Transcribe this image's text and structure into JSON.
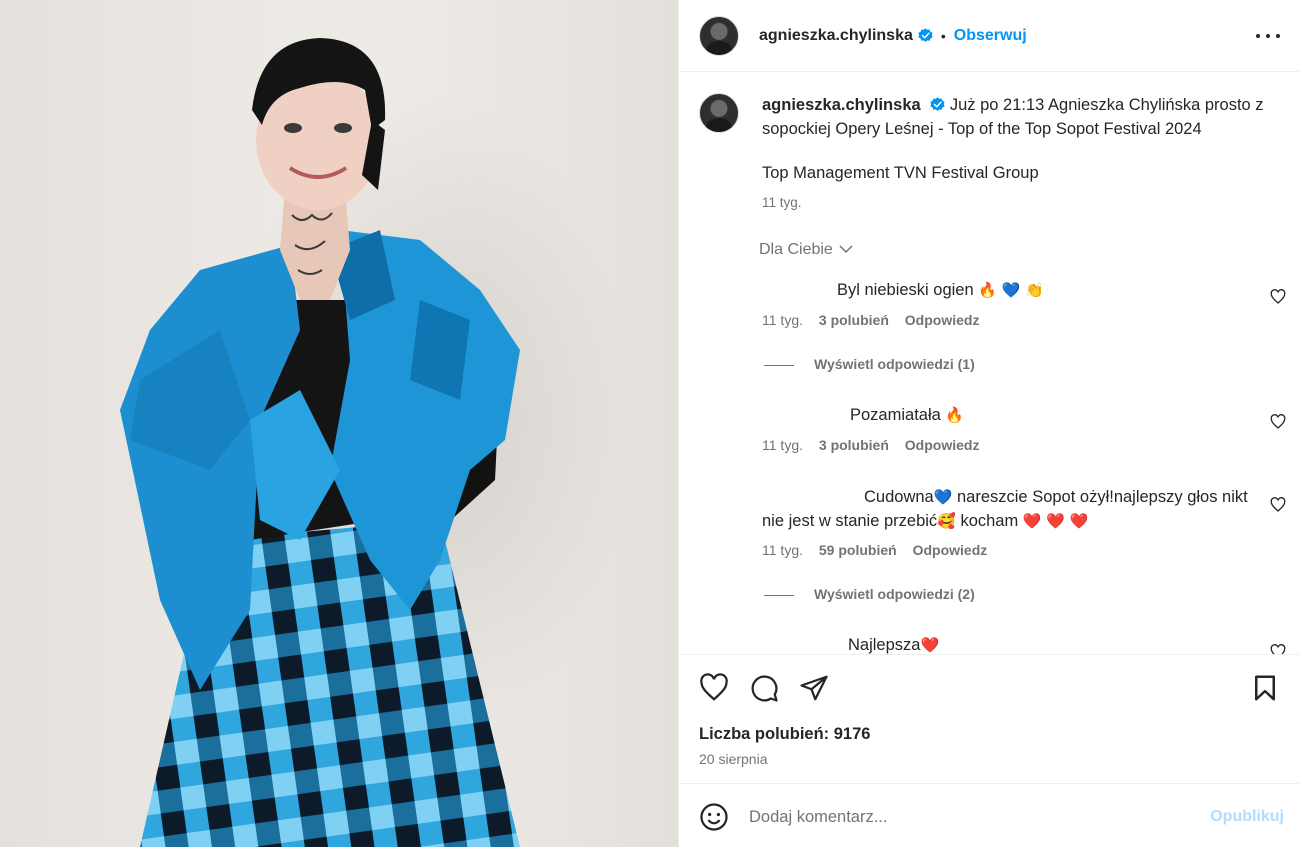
{
  "post": {
    "username": "agnieszka.chylinska",
    "follow_label": "Obserwuj",
    "dot": "•"
  },
  "caption": {
    "username": "agnieszka.chylinska",
    "text": "Już po 21:13 Agnieszka Chylińska prosto z sopockiej Opery Leśnej - Top of the Top Sopot Festival 2024",
    "extra": "Top Management TVN Festival Group",
    "time": "11 tyg."
  },
  "sort_label": "Dla Ciebie",
  "comments": [
    {
      "text": "Byl niebieski ogien",
      "emojis": "🔥 💙 👏",
      "time": "11 tyg.",
      "likes": "3 polubień",
      "reply": "Odpowiedz",
      "view_replies": "Wyświetl odpowiedzi (1)"
    },
    {
      "text": "Pozamiatała",
      "emojis": "🔥",
      "time": "11 tyg.",
      "likes": "3 polubień",
      "reply": "Odpowiedz"
    },
    {
      "text_a": "Cudowna",
      "emoji_a": "💙",
      "text_b": " nareszcie Sopot ożył!najlepszy głos nikt nie jest w stanie przebić",
      "emoji_b": "🥰",
      "text_c": " kocham ",
      "emoji_c": "❤️ ❤️ ❤️",
      "time": "11 tyg.",
      "likes": "59 polubień",
      "reply": "Odpowiedz",
      "view_replies": "Wyświetl odpowiedzi (2)"
    },
    {
      "text": "Najlepsza",
      "emojis": "❤️"
    }
  ],
  "likes_label": "Liczba polubień: 9176",
  "date": "20 sierpnia",
  "add_comment": {
    "placeholder": "Dodaj komentarz...",
    "post_label": "Opublikuj"
  },
  "icons": [
    "verified-badge-icon",
    "more-options-icon",
    "heart-icon",
    "comment-icon",
    "share-icon",
    "bookmark-icon",
    "emoji-icon",
    "chevron-down-icon"
  ],
  "colors": {
    "accent": "#0095f6",
    "text": "#262626",
    "muted": "#737373",
    "post_disabled": "#b3dbff",
    "jacket": "#1d8fd0"
  }
}
